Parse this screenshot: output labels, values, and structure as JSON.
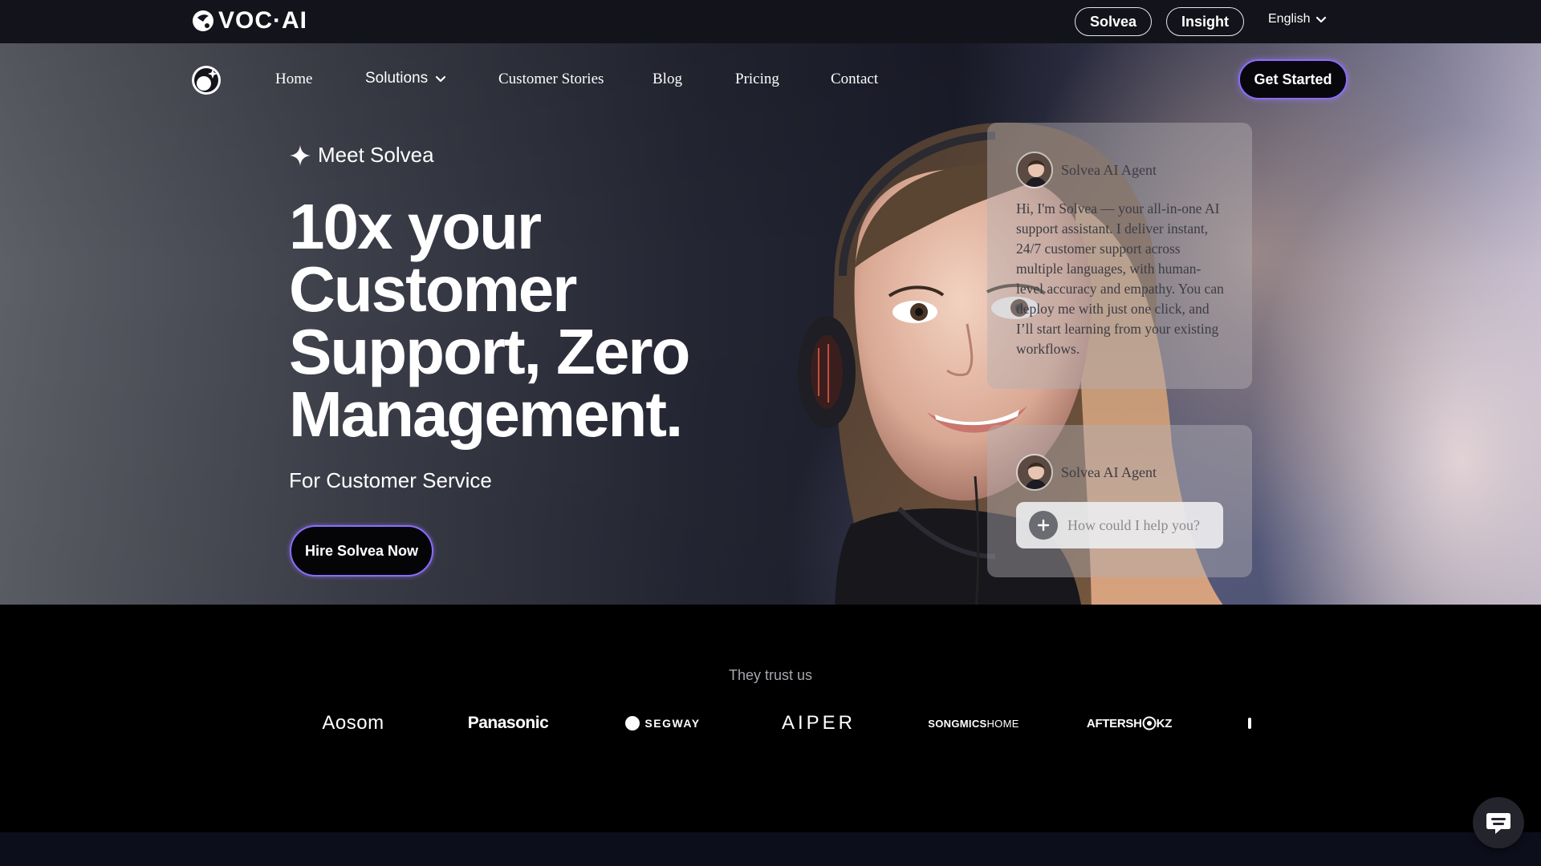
{
  "topbar": {
    "brand": "VOC·AI",
    "solvea_label": "Solvea",
    "insight_label": "Insight",
    "language": "English"
  },
  "nav": {
    "items": [
      {
        "label": "Home"
      },
      {
        "label": "Solutions"
      },
      {
        "label": "Customer Stories"
      },
      {
        "label": "Blog"
      },
      {
        "label": "Pricing"
      },
      {
        "label": "Contact"
      }
    ],
    "cta_label": "Get Started"
  },
  "hero": {
    "eyebrow": "Meet Solvea",
    "headline_lines": [
      "10x your",
      "Customer",
      "Support, Zero",
      "Management."
    ],
    "subtitle": "For Customer Service",
    "cta_label": "Hire Solvea Now"
  },
  "chat": {
    "agent_name": "Solvea AI Agent",
    "message": "Hi, I'm Solvea — your all-in-one AI support assistant. I deliver instant, 24/7 customer support across multiple languages, with human-level accuracy and empathy. You can deploy me with just one click, and I’ll start learning from your existing workflows.",
    "input_placeholder": "How could I help you?"
  },
  "trust": {
    "title": "They trust us",
    "logos": [
      "Aosom",
      "Panasonic",
      "SEGWAY",
      "AIPER",
      "SONGMICS",
      "HOME",
      "AFTERSH",
      "KZ"
    ]
  },
  "icons": {
    "brand": "voc-ai-logo-icon",
    "sparkle": "sparkle-icon",
    "chevron": "chevron-down-icon",
    "plus": "plus-icon",
    "chat": "chat-bubble-icon"
  },
  "colors": {
    "cta_border": "#8a6cff",
    "topbar_bg": "#13131b",
    "trust_bg": "#000000"
  }
}
